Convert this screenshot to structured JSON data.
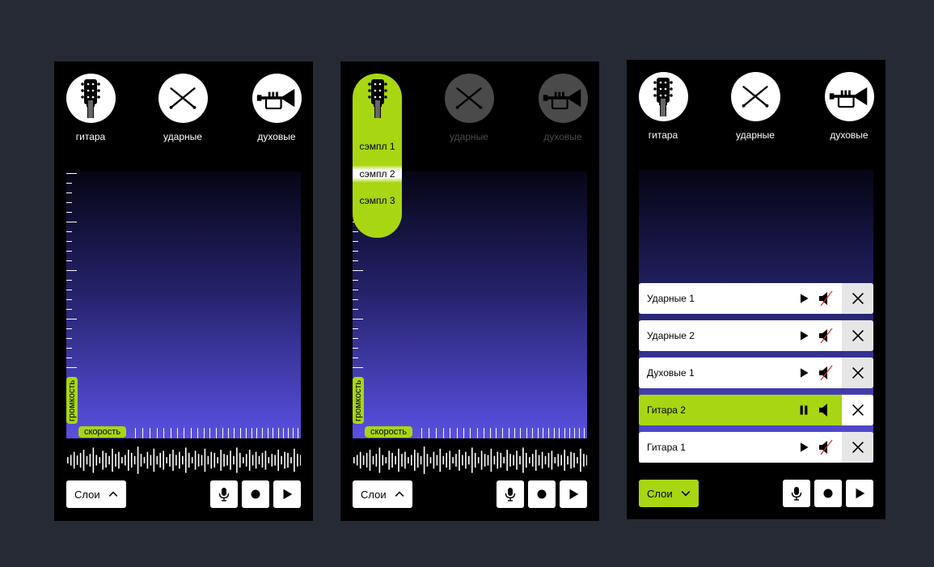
{
  "instruments": [
    {
      "label": "гитара",
      "icon": "guitar-headstock-icon"
    },
    {
      "label": "ударные",
      "icon": "drumsticks-icon"
    },
    {
      "label": "духовые",
      "icon": "trumpet-icon"
    }
  ],
  "sliders": {
    "volume_label": "громкость",
    "speed_label": "скорость"
  },
  "sample_menu": {
    "options": [
      "сэмпл 1",
      "сэмпл 2",
      "сэмпл 3"
    ],
    "selected": "сэмпл 2"
  },
  "bottom_bar": {
    "layers_label": "Слои"
  },
  "layers": [
    {
      "name": "Ударные 1",
      "state": "paused",
      "muted": true
    },
    {
      "name": "Ударные 2",
      "state": "paused",
      "muted": true
    },
    {
      "name": "Духовые 1",
      "state": "paused",
      "muted": true
    },
    {
      "name": "Гитара 2",
      "state": "playing",
      "muted": false
    },
    {
      "name": "Гитара 1",
      "state": "paused",
      "muted": true
    }
  ],
  "colors": {
    "page_bg": "#262a34",
    "accent": "#a8d612",
    "gradient_bottom": "#5a50e2"
  }
}
